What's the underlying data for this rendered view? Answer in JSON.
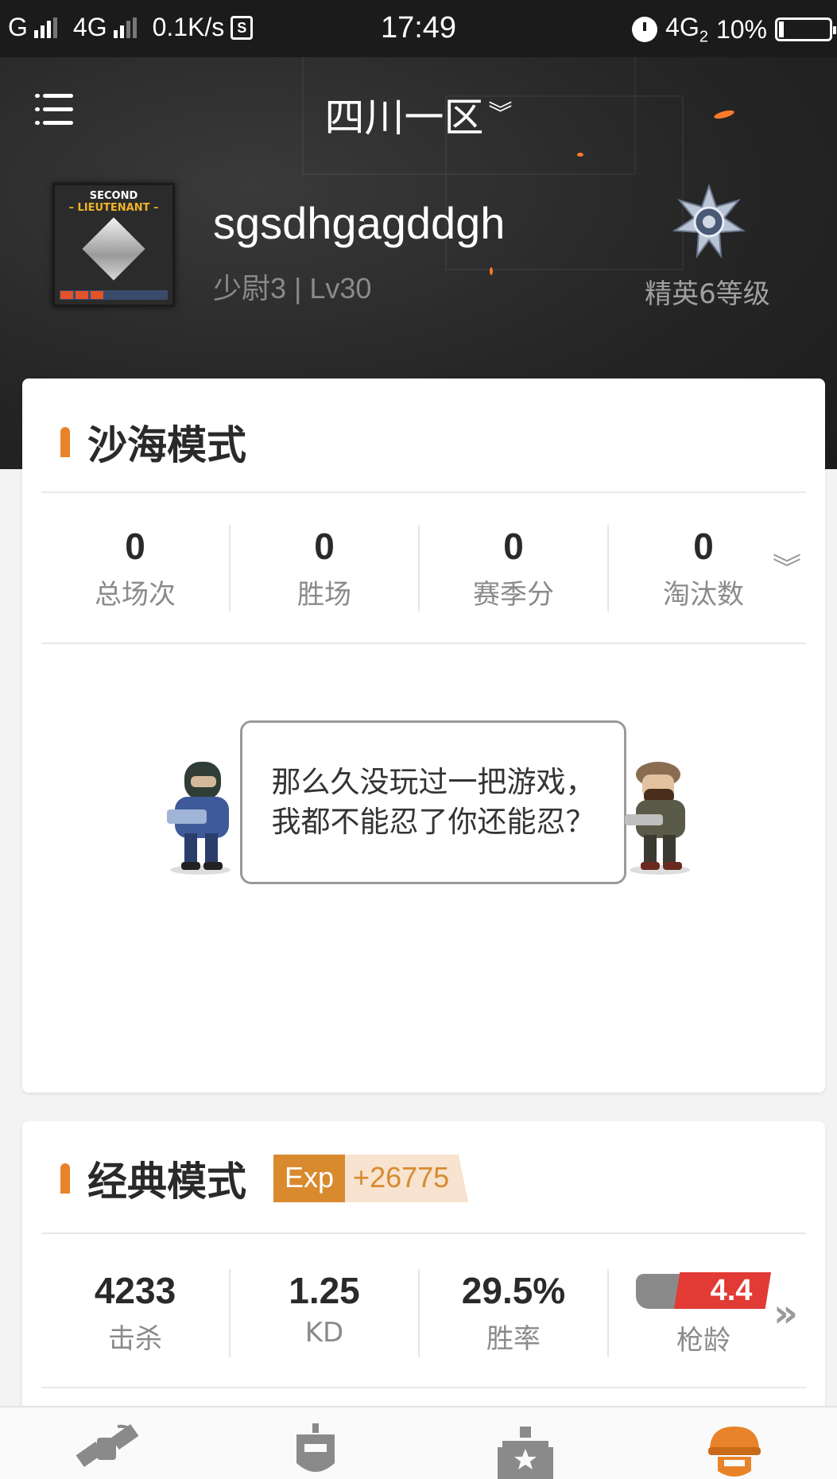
{
  "status_bar": {
    "carrier1": "G",
    "carrier2": "4G",
    "speed": "0.1K/s",
    "time": "17:49",
    "network": "4G",
    "network_sub": "2",
    "battery": "10%"
  },
  "header": {
    "server": "四川一区",
    "username": "sgsdhgagddgh",
    "level": "少尉3 | Lv30",
    "elite_label": "精英6等级",
    "avatar_rank_top": "SECOND",
    "avatar_rank_bottom": "– LIEUTENANT –"
  },
  "sand_mode": {
    "title": "沙海模式",
    "stats": [
      {
        "value": "0",
        "label": "总场次"
      },
      {
        "value": "0",
        "label": "胜场"
      },
      {
        "value": "0",
        "label": "赛季分"
      },
      {
        "value": "0",
        "label": "淘汰数"
      }
    ],
    "empty_message": "那么久没玩过一把游戏，我都不能忍了你还能忍？"
  },
  "classic_mode": {
    "title": "经典模式",
    "exp_key": "Exp",
    "exp_value": "+26775",
    "stats": [
      {
        "value": "4233",
        "label": "击杀"
      },
      {
        "value": "1.25",
        "label": "KD"
      },
      {
        "value": "29.5%",
        "label": "胜率"
      }
    ],
    "gun_age_value": "4.4",
    "gun_age_label": "枪龄"
  },
  "colors": {
    "accent": "#e8832a",
    "exp": "#d98a2e",
    "gun_age": "#e23a34",
    "nav_active": "#e8832a"
  },
  "bottom_nav": [
    {
      "icon": "satellite-icon"
    },
    {
      "icon": "helmet-robot-icon"
    },
    {
      "icon": "castle-icon"
    },
    {
      "icon": "soldier-helmet-icon",
      "active": true
    }
  ]
}
